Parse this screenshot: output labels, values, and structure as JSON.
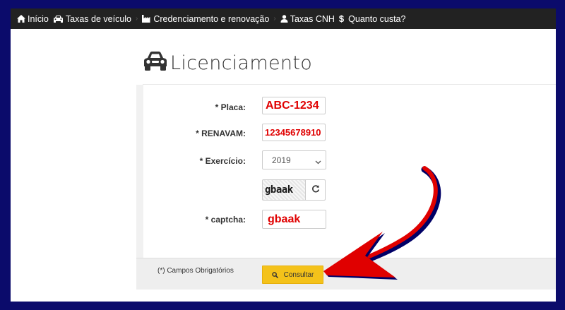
{
  "navbar": {
    "items": [
      {
        "label": "Início",
        "icon": "home-icon"
      },
      {
        "label": "Taxas de veículo",
        "icon": "car-icon"
      },
      {
        "label": "Credenciamento e renovação",
        "icon": "industry-icon"
      },
      {
        "label": "Taxas CNH",
        "icon": "user-icon"
      },
      {
        "label": "Quanto custa?",
        "icon": "dollar-icon"
      }
    ]
  },
  "page": {
    "title": "Licenciamento",
    "title_icon": "car-icon"
  },
  "form": {
    "placa_label": "* Placa:",
    "placa_value": "ABC-1234",
    "renavam_label": "* RENAVAM:",
    "renavam_value": "12345678910",
    "exercicio_label": "* Exercício:",
    "exercicio_value": "2019",
    "captcha_image_text": "gbaak",
    "captcha_label": "* captcha:",
    "captcha_value": "gbaak"
  },
  "footer": {
    "required_note": "(*) Campos Obrigatórios",
    "submit_label": "Consultar"
  },
  "colors": {
    "navbar_bg": "#222222",
    "frame_border": "#0b0b6b",
    "button_bg": "#f4c21a",
    "input_text": "#e00000",
    "arrow": "#e00000"
  }
}
